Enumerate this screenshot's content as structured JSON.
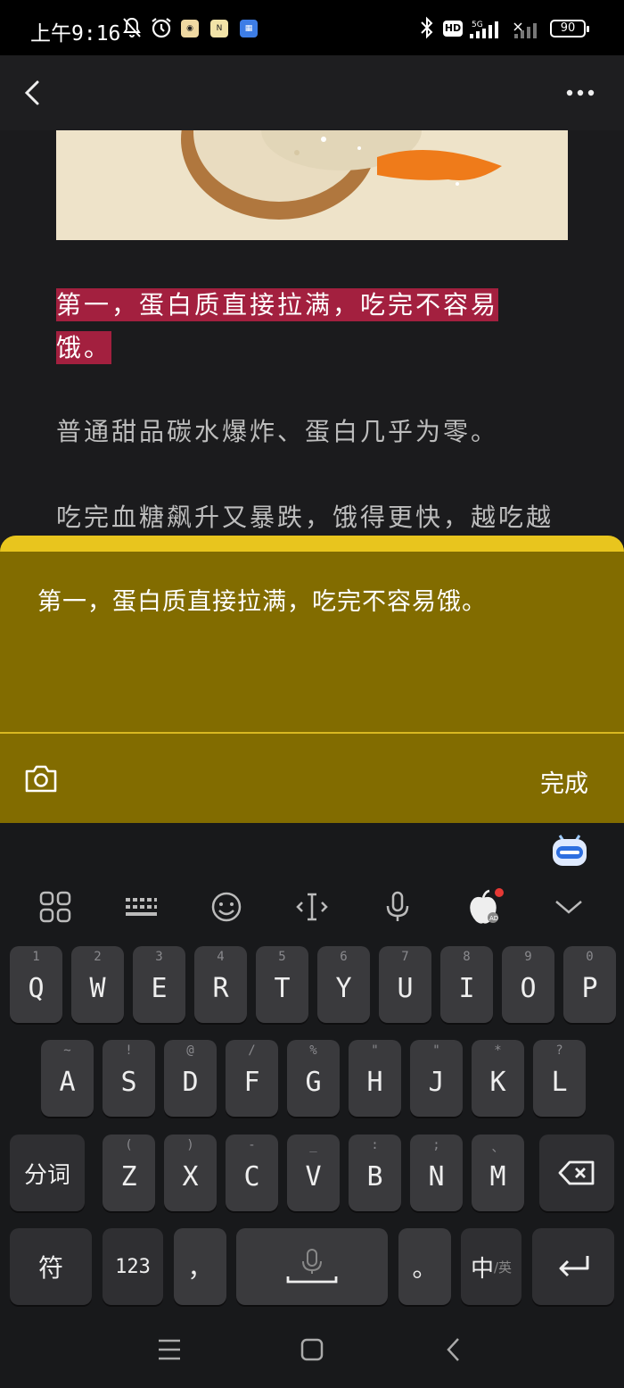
{
  "status_bar": {
    "time": "上午9:16",
    "battery": "90",
    "hd": "HD",
    "network": "5G"
  },
  "article": {
    "highlighted_text_line1": "第一，蛋白质直接拉满，吃完不容易",
    "highlighted_text_line2": "饿。",
    "paragraph1": "普通甜品碳水爆炸、蛋白几乎为零。",
    "paragraph2": "吃完血糖飙升又暴跌，饿得更快，越吃越"
  },
  "note_editor": {
    "text": "第一，蛋白质直接拉满，吃完不容易饿。",
    "done_label": "完成"
  },
  "keyboard": {
    "row1": [
      {
        "sub": "1",
        "key": "Q"
      },
      {
        "sub": "2",
        "key": "W"
      },
      {
        "sub": "3",
        "key": "E"
      },
      {
        "sub": "4",
        "key": "R"
      },
      {
        "sub": "5",
        "key": "T"
      },
      {
        "sub": "6",
        "key": "Y"
      },
      {
        "sub": "7",
        "key": "U"
      },
      {
        "sub": "8",
        "key": "I"
      },
      {
        "sub": "9",
        "key": "O"
      },
      {
        "sub": "0",
        "key": "P"
      }
    ],
    "row2": [
      {
        "sub": "~",
        "key": "A"
      },
      {
        "sub": "!",
        "key": "S"
      },
      {
        "sub": "@",
        "key": "D"
      },
      {
        "sub": "/",
        "key": "F"
      },
      {
        "sub": "%",
        "key": "G"
      },
      {
        "sub": "\"",
        "key": "H"
      },
      {
        "sub": "\"",
        "key": "J"
      },
      {
        "sub": "*",
        "key": "K"
      },
      {
        "sub": "?",
        "key": "L"
      }
    ],
    "row3": [
      {
        "sub": "(",
        "key": "Z"
      },
      {
        "sub": ")",
        "key": "X"
      },
      {
        "sub": "-",
        "key": "C"
      },
      {
        "sub": "_",
        "key": "V"
      },
      {
        "sub": ":",
        "key": "B"
      },
      {
        "sub": ";",
        "key": "N"
      },
      {
        "sub": "、",
        "key": "M"
      }
    ],
    "segment_label": "分词",
    "symbol_label": "符",
    "num_label": "123",
    "comma_label": "，",
    "period_label": "。",
    "lang_label": "中",
    "lang_sub_label": "/英"
  },
  "colors": {
    "highlight": "#a3203f",
    "note_bg": "#826c00",
    "note_accent": "#e8c51e"
  }
}
